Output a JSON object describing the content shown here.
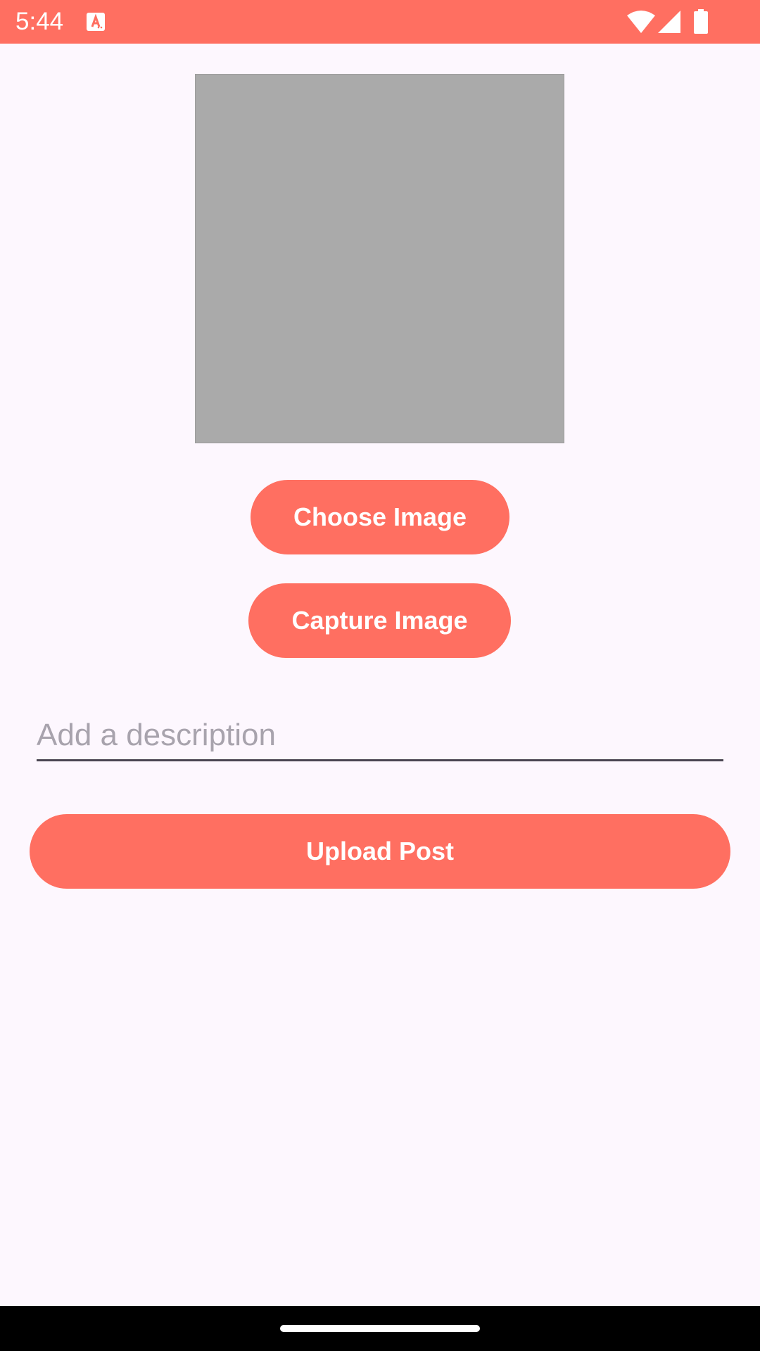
{
  "status_bar": {
    "time": "5:44",
    "background": "#ff6f61",
    "icons": [
      "app-notification-icon",
      "wifi-icon",
      "signal-icon",
      "battery-icon"
    ]
  },
  "image_preview": {
    "placeholder_color": "#aaaaaa"
  },
  "buttons": {
    "choose_image": "Choose Image",
    "capture_image": "Capture Image",
    "upload_post": "Upload Post",
    "color": "#ff6f61"
  },
  "description": {
    "placeholder": "Add a description",
    "value": ""
  },
  "nav_bar": {
    "icons": [
      "home-handle"
    ]
  }
}
